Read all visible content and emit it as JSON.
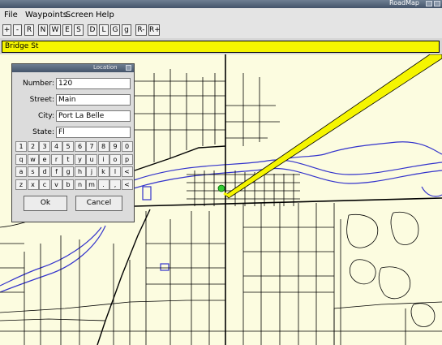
{
  "window": {
    "title": "RoadMap"
  },
  "menu": {
    "file": "File",
    "waypoints": "Waypoints",
    "screen": "Screen",
    "help": "Help"
  },
  "toolbar": [
    "+",
    "-",
    "R",
    "N",
    "W",
    "E",
    "S",
    "D",
    "L",
    "G",
    "g",
    "R-",
    "R+"
  ],
  "street_bar": {
    "name": "Bridge St"
  },
  "dialog": {
    "title": "Location",
    "fields": {
      "number": {
        "label": "Number:",
        "value": "120"
      },
      "street": {
        "label": "Street:",
        "value": "Main"
      },
      "city": {
        "label": "City:",
        "value": "Port La Belle"
      },
      "state": {
        "label": "State:",
        "value": "Fl"
      }
    },
    "keyboard": [
      [
        "1",
        "2",
        "3",
        "4",
        "5",
        "6",
        "7",
        "8",
        "9",
        "0"
      ],
      [
        "q",
        "w",
        "e",
        "r",
        "t",
        "y",
        "u",
        "i",
        "o",
        "p"
      ],
      [
        "a",
        "s",
        "d",
        "f",
        "g",
        "h",
        "j",
        "k",
        "l",
        "<"
      ],
      [
        "z",
        "x",
        "c",
        "v",
        "b",
        "n",
        "m",
        ".",
        ",",
        "<"
      ]
    ],
    "ok_label": "Ok",
    "cancel_label": "Cancel"
  },
  "colors": {
    "map_background": "#fcfce0",
    "road": "#000000",
    "water": "#3333cc",
    "highlight": "#f5f500",
    "gps_marker": "#33cc33"
  }
}
